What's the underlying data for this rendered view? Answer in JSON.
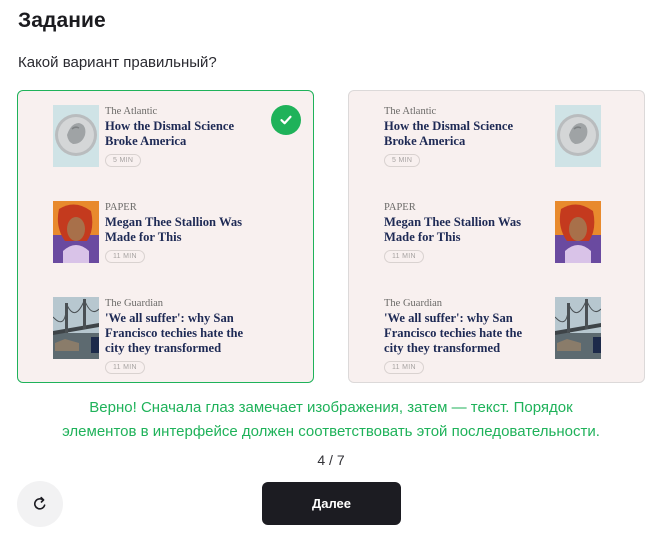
{
  "task": {
    "title": "Задание",
    "question": "Какой вариант правильный?"
  },
  "articles": [
    {
      "source": "The Atlantic",
      "headline": "How the Dismal Science Broke America",
      "read_time": "5 MIN",
      "image": "coin-icon"
    },
    {
      "source": "PAPER",
      "headline": "Megan Thee Stallion Was Made for This",
      "read_time": "11 MIN",
      "image": "portrait-icon"
    },
    {
      "source": "The Guardian",
      "headline": "'We all suffer': why San Francisco techies hate the city they transformed",
      "read_time": "11 MIN",
      "image": "bridge-icon"
    }
  ],
  "options": {
    "left": {
      "image_side": "left",
      "state": "correct",
      "border_color": "#1fb25a"
    },
    "right": {
      "image_side": "right",
      "state": "unselected",
      "border_color": "#dcd9d9"
    }
  },
  "feedback": {
    "line1": "Верно! Сначала глаз замечает изображения, затем — текст. Порядок",
    "line2": "элементов в интерфейсе должен соответствовать этой последовательности.",
    "color": "#1fb25a"
  },
  "progress": {
    "text": "4 / 7"
  },
  "buttons": {
    "next_label": "Далее",
    "reload_icon": "reload-icon"
  },
  "colors": {
    "success": "#1fb25a",
    "card_bg": "#f8f0ef",
    "headline": "#1e2a55",
    "button_dark": "#1c1c22"
  }
}
